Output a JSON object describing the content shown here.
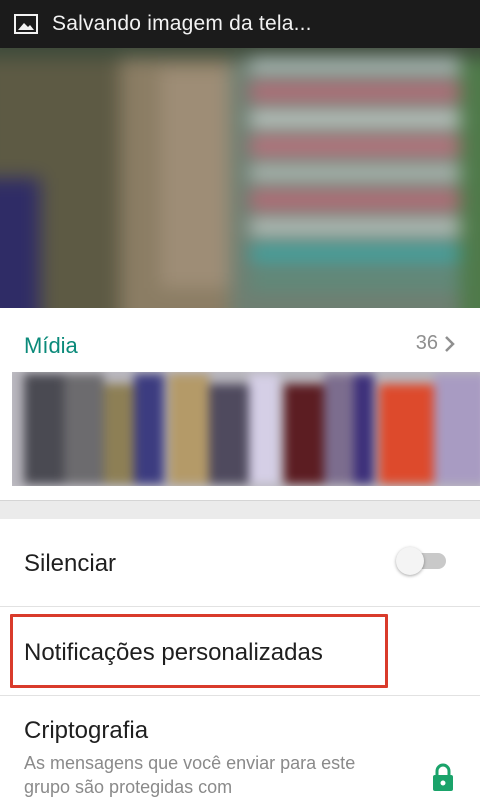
{
  "status_bar": {
    "icon": "image-icon",
    "text": "Salvando imagem da tela..."
  },
  "media": {
    "title": "Mídia",
    "count": "36",
    "chevron_icon": "chevron-right-icon"
  },
  "settings": {
    "mute": {
      "label": "Silenciar",
      "toggle_on": false
    },
    "custom_notifications": {
      "label": "Notificações personalizadas",
      "highlight_color": "#d93b2b"
    },
    "encryption": {
      "label": "Criptografia",
      "description": "As mensagens que você enviar para este grupo são protegidas com",
      "icon": "lock-icon",
      "icon_color": "#1aa36a"
    }
  },
  "colors": {
    "accent": "#0b8a7a",
    "status_bar_bg": "#1b1b1b"
  }
}
